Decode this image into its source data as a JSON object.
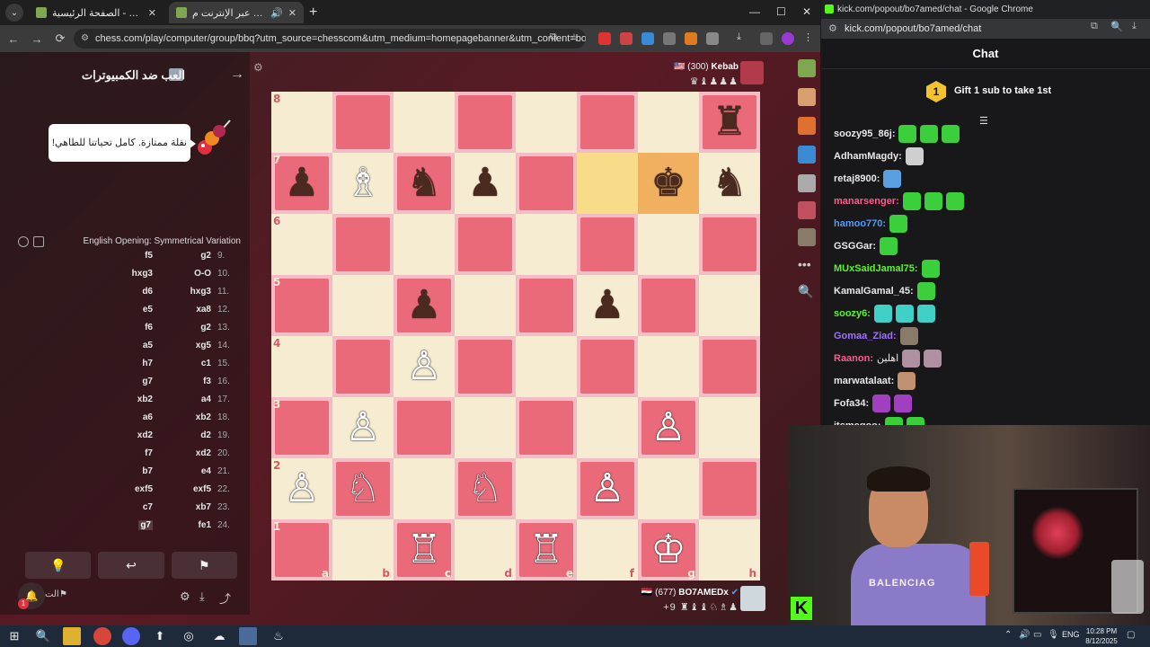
{
  "browser": {
    "tabs": [
      {
        "label": "الصفحة الرئيسية - Chess.com",
        "active": false
      },
      {
        "label": "العب الشطرنج عبر الإنترنت م...",
        "active": true
      }
    ],
    "url": "chess.com/play/computer/group/bbq?utm_source=chesscom&utm_medium=homepagebanner&utm_content=bots_b..."
  },
  "sidebar": {
    "title": "العب ضد الكمبيوترات",
    "bubble": "نقلة ممتازة. كامل تحياتنا للطاهي!",
    "opening": "English Opening: Symmetrical Variation",
    "moves": [
      {
        "n": "9.",
        "w": "g2",
        "b": "f5"
      },
      {
        "n": "10.",
        "w": "O-O",
        "b": "hxg3"
      },
      {
        "n": "11.",
        "w": "hxg3",
        "b": "d6"
      },
      {
        "n": "12.",
        "w": "xa8",
        "b": "e5"
      },
      {
        "n": "13.",
        "w": "g2",
        "b": "f6"
      },
      {
        "n": "14.",
        "w": "xg5",
        "b": "a5"
      },
      {
        "n": "15.",
        "w": "c1",
        "b": "h7"
      },
      {
        "n": "16.",
        "w": "f3",
        "b": "g7"
      },
      {
        "n": "17.",
        "w": "a4",
        "b": "xb2"
      },
      {
        "n": "18.",
        "w": "xb2",
        "b": "a6"
      },
      {
        "n": "19.",
        "w": "d2",
        "b": "xd2"
      },
      {
        "n": "20.",
        "w": "xd2",
        "b": "f7"
      },
      {
        "n": "21.",
        "w": "e4",
        "b": "b7"
      },
      {
        "n": "22.",
        "w": "exf5",
        "b": "exf5"
      },
      {
        "n": "23.",
        "w": "xb7",
        "b": "c7"
      },
      {
        "n": "24.",
        "w": "fe1",
        "b": "g7"
      }
    ],
    "bottom_label": "الت"
  },
  "board": {
    "ranks": [
      "8",
      "7",
      "6",
      "5",
      "4",
      "3",
      "2",
      "1"
    ],
    "files": [
      "a",
      "b",
      "c",
      "d",
      "e",
      "f",
      "g",
      "h"
    ],
    "position": [
      [
        "",
        "",
        "",
        "",
        "",
        "",
        "",
        "bR"
      ],
      [
        "bP",
        "wB",
        "bN",
        "bP",
        "",
        "",
        "bK",
        "bN"
      ],
      [
        "",
        "",
        "",
        "",
        "",
        "",
        "",
        ""
      ],
      [
        "",
        "",
        "bP",
        "",
        "",
        "bP",
        "",
        ""
      ],
      [
        "",
        "",
        "wP",
        "",
        "",
        "",
        "",
        ""
      ],
      [
        "",
        "wP",
        "",
        "",
        "",
        "",
        "wP",
        ""
      ],
      [
        "wP",
        "wN",
        "",
        "wN",
        "",
        "wP",
        "",
        ""
      ],
      [
        "",
        "",
        "wR",
        "",
        "wR",
        "",
        "wK",
        ""
      ]
    ],
    "highlight": [
      "f7",
      "g7"
    ]
  },
  "top_player": {
    "name": "Kebab",
    "rating": "(300)",
    "captures": "♛♝♟♟♟"
  },
  "bottom_player": {
    "name": "BO7AMEDx",
    "rating": "(677)",
    "advantage": "+9",
    "captures": "♜♝♝♘♗♟"
  },
  "chat_window": {
    "title": "kick.com/popout/bo7amed/chat - Google Chrome",
    "url": "kick.com/popout/bo7amed/chat",
    "header": "Chat",
    "gift_count": "1",
    "gift_text": "Gift 1 sub to take 1st",
    "messages": [
      {
        "user": "soozy95_86j:",
        "color": "#e8e8e8",
        "text": "",
        "emotes": 3,
        "emote_color": "#3ccf3c"
      },
      {
        "user": "AdhamMagdy:",
        "color": "#e8e8e8",
        "text": "",
        "emotes": 1,
        "emote_color": "#cfcfcf"
      },
      {
        "user": "retaj8900:",
        "color": "#e8e8e8",
        "text": "",
        "emotes": 1,
        "emote_color": "#5aa0e0"
      },
      {
        "user": "manarsenger:",
        "color": "#ff5a8a",
        "text": "",
        "emotes": 3,
        "emote_color": "#3ccf3c"
      },
      {
        "user": "hamoo770:",
        "color": "#4a9cff",
        "text": "",
        "emotes": 1,
        "emote_color": "#3ccf3c"
      },
      {
        "user": "GSGGar:",
        "color": "#e8e8e8",
        "text": "",
        "emotes": 1,
        "emote_color": "#3ccf3c"
      },
      {
        "user": "MUxSaidJamal75:",
        "color": "#53fc18",
        "text": "",
        "emotes": 1,
        "emote_color": "#3ccf3c"
      },
      {
        "user": "KamalGamal_45:",
        "color": "#e8e8e8",
        "text": "",
        "emotes": 1,
        "emote_color": "#3ccf3c"
      },
      {
        "user": "soozy6:",
        "color": "#53fc18",
        "text": "",
        "emotes": 3,
        "emote_color": "#40d0c8"
      },
      {
        "user": "Gomaa_Ziad:",
        "color": "#a070ff",
        "text": "",
        "emotes": 1,
        "emote_color": "#8a7a6a"
      },
      {
        "user": "Raanon:",
        "color": "#ff5a8a",
        "text": "اهلين",
        "emotes": 2,
        "emote_color": "#b090a0"
      },
      {
        "user": "marwatalaat:",
        "color": "#e8e8e8",
        "text": "",
        "emotes": 1,
        "emote_color": "#c09070"
      },
      {
        "user": "Fofa34:",
        "color": "#e8e8e8",
        "text": "",
        "emotes": 2,
        "emote_color": "#a040c0"
      },
      {
        "user": "itsmegoo:",
        "color": "#e8e8e8",
        "text": "",
        "emotes": 2,
        "emote_color": "#3ccf3c"
      }
    ]
  },
  "webcam": {
    "shirt_text": "BALENCIAG"
  },
  "taskbar": {
    "lang": "ENG",
    "time": "10:28 PM",
    "date": "8/12/2025"
  },
  "colors": {
    "accent": "#53fc18",
    "board_dark": "#ea6a7a",
    "board_light": "#f6ecd2"
  }
}
